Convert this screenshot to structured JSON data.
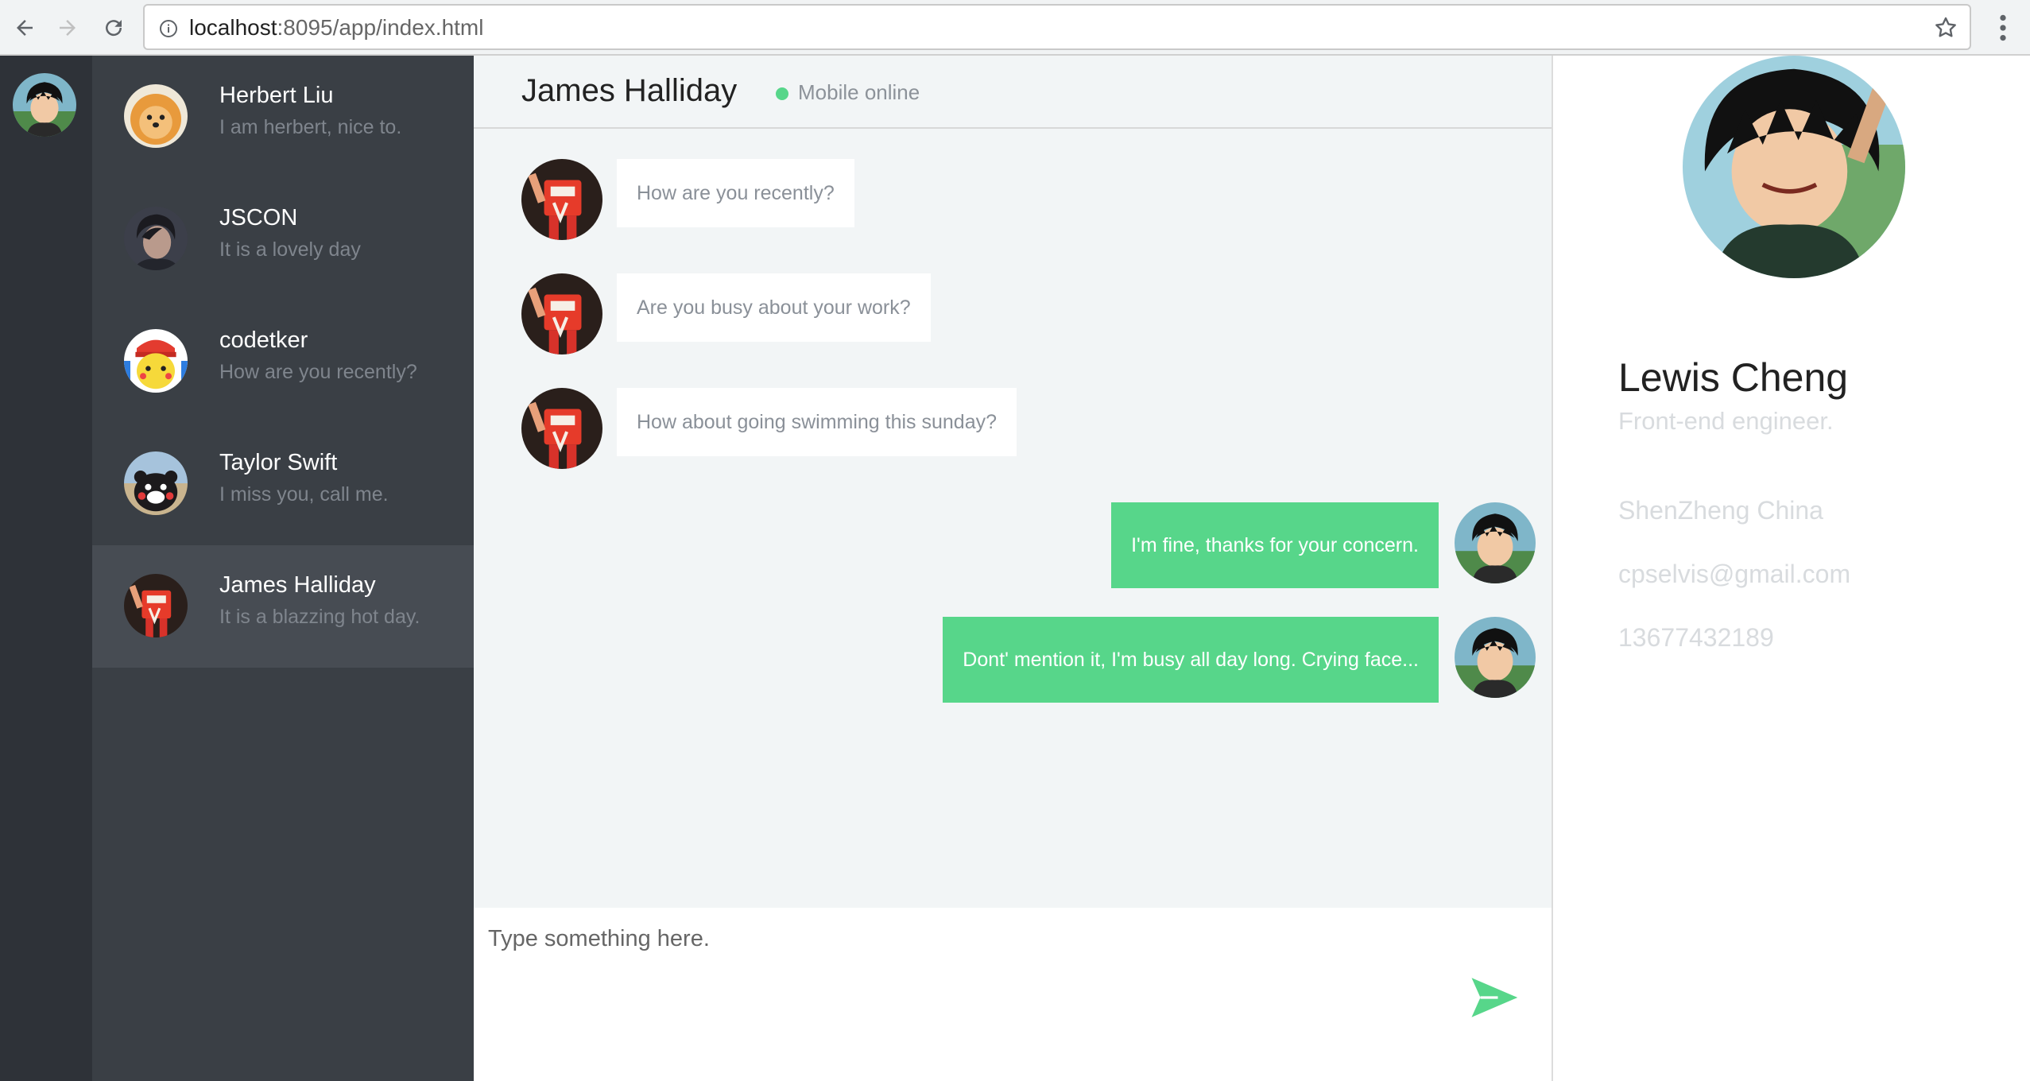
{
  "browser": {
    "url_host": "localhost",
    "url_rest": ":8095/app/index.html"
  },
  "contacts": [
    {
      "name": "Herbert Liu",
      "message": "I am herbert, nice to."
    },
    {
      "name": "JSCON",
      "message": "It is a lovely day"
    },
    {
      "name": "codetker",
      "message": "How are you recently?"
    },
    {
      "name": "Taylor Swift",
      "message": "I miss you, call me."
    },
    {
      "name": "James Halliday",
      "message": "It is a blazzing hot day."
    }
  ],
  "chat": {
    "title": "James Halliday",
    "status": "Mobile online",
    "status_color": "#57d68a",
    "incoming": [
      "How are you recently?",
      "Are you busy about your work?",
      "How about going swimming this sunday?"
    ],
    "outgoing": [
      "I'm fine, thanks for your concern.",
      "Dont' mention it, I'm busy all day long. Crying face..."
    ],
    "composer_placeholder": "Type something here."
  },
  "profile": {
    "name": "Lewis Cheng",
    "role": "Front-end engineer.",
    "location": "ShenZheng China",
    "email": "cpselvis@gmail.com",
    "phone": "13677432189"
  },
  "colors": {
    "accent": "#57d68a",
    "rail": "#2e3238",
    "list": "#3a3f45",
    "list_active": "#474c53",
    "chat_bg": "#f2f5f6"
  }
}
